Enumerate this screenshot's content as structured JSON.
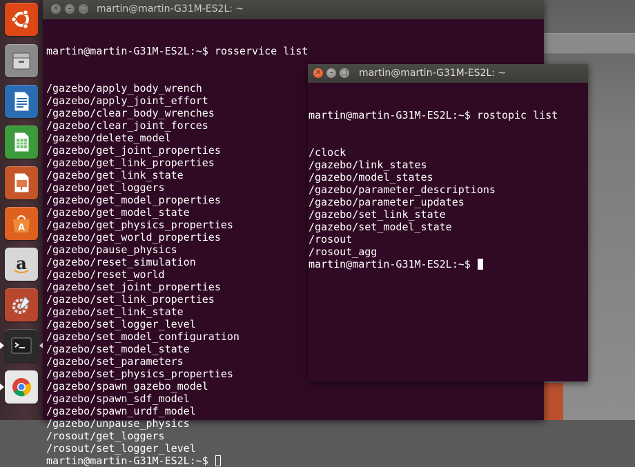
{
  "launcher": {
    "items": [
      {
        "name": "ubuntu-dash-icon",
        "color": "#dd4814"
      },
      {
        "name": "files-icon",
        "color": "#8b8b8b"
      },
      {
        "name": "libreoffice-writer-icon",
        "color": "#2a6db3"
      },
      {
        "name": "libreoffice-calc-icon",
        "color": "#3c9c3c"
      },
      {
        "name": "libreoffice-impress-icon",
        "color": "#c5562a"
      },
      {
        "name": "software-center-icon",
        "color": "#e0611f"
      },
      {
        "name": "amazon-icon",
        "color": "#d8d8d8",
        "glyph": "a"
      },
      {
        "name": "system-settings-icon",
        "color": "#b9472e"
      },
      {
        "name": "terminal-icon",
        "color": "#2b2b2b",
        "glyph": ">_"
      },
      {
        "name": "chrome-icon",
        "color": "#e9e9e9"
      }
    ]
  },
  "terminal1": {
    "title": "martin@martin-G31M-ES2L: ~",
    "prompt": "martin@martin-G31M-ES2L:~$ ",
    "command": "rosservice list",
    "output": [
      "/gazebo/apply_body_wrench",
      "/gazebo/apply_joint_effort",
      "/gazebo/clear_body_wrenches",
      "/gazebo/clear_joint_forces",
      "/gazebo/delete_model",
      "/gazebo/get_joint_properties",
      "/gazebo/get_link_properties",
      "/gazebo/get_link_state",
      "/gazebo/get_loggers",
      "/gazebo/get_model_properties",
      "/gazebo/get_model_state",
      "/gazebo/get_physics_properties",
      "/gazebo/get_world_properties",
      "/gazebo/pause_physics",
      "/gazebo/reset_simulation",
      "/gazebo/reset_world",
      "/gazebo/set_joint_properties",
      "/gazebo/set_link_properties",
      "/gazebo/set_link_state",
      "/gazebo/set_logger_level",
      "/gazebo/set_model_configuration",
      "/gazebo/set_model_state",
      "/gazebo/set_parameters",
      "/gazebo/set_physics_properties",
      "/gazebo/spawn_gazebo_model",
      "/gazebo/spawn_sdf_model",
      "/gazebo/spawn_urdf_model",
      "/gazebo/unpause_physics",
      "/rosout/get_loggers",
      "/rosout/set_logger_level"
    ],
    "final_prompt": "martin@martin-G31M-ES2L:~$ "
  },
  "terminal2": {
    "title": "martin@martin-G31M-ES2L: ~",
    "prompt": "martin@martin-G31M-ES2L:~$ ",
    "command": "rostopic list",
    "output": [
      "/clock",
      "/gazebo/link_states",
      "/gazebo/model_states",
      "/gazebo/parameter_descriptions",
      "/gazebo/parameter_updates",
      "/gazebo/set_link_state",
      "/gazebo/set_model_state",
      "/rosout",
      "/rosout_agg"
    ],
    "final_prompt": "martin@martin-G31M-ES2L:~$ "
  },
  "colors": {
    "terminal_bg": "#300a24",
    "titlebar": "#3c3b37",
    "close_button": "#df4a16"
  }
}
